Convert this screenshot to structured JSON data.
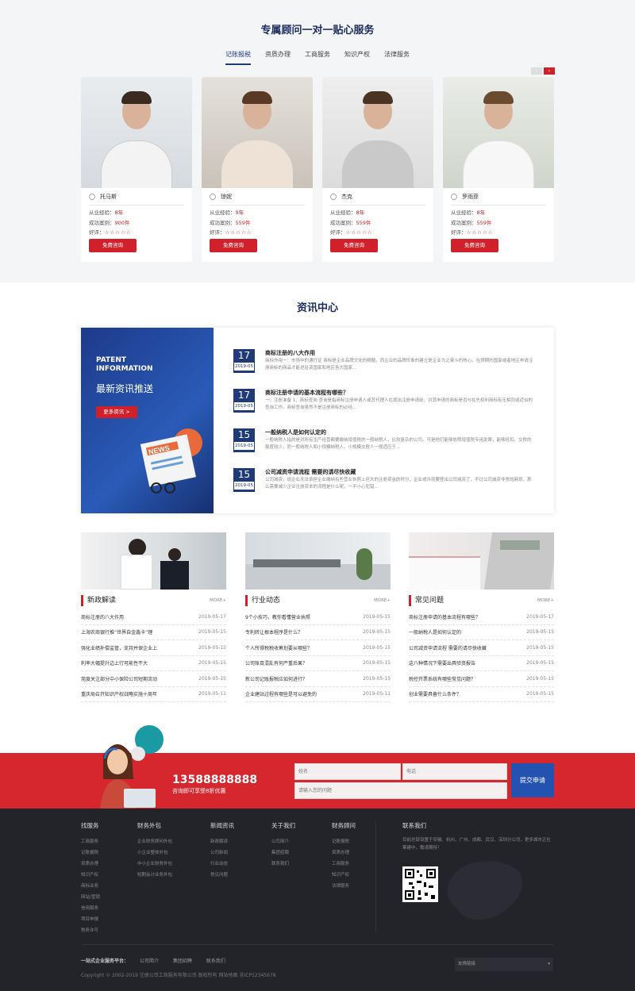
{
  "consult": {
    "title": "专属顾问一对一贴心服务",
    "tabs": [
      "记账报税",
      "资质办理",
      "工商服务",
      "知识产权",
      "法律服务"
    ],
    "exp_label": "从业经验：",
    "cases_label": "成功案例：",
    "rating_label": "好评：",
    "stars": "☆☆☆☆☆",
    "btn": "免费咨询",
    "advisors": [
      {
        "name": "托马斯",
        "exp": "8年",
        "cases": "900件"
      },
      {
        "name": "琼妮",
        "exp": "9年",
        "cases": "559件"
      },
      {
        "name": "杰克",
        "exp": "8年",
        "cases": "559件"
      },
      {
        "name": "罗雨菲",
        "exp": "8年",
        "cases": "559件"
      }
    ]
  },
  "news": {
    "title": "资讯中心",
    "banner_en": "PATENT INFORMATION",
    "banner_cn": "最新资讯推送",
    "banner_btn": "更多资讯 >",
    "banner_news": "NEWS",
    "items": [
      {
        "day": "17",
        "ym": "2019-05",
        "title": "商标注册的八大作用",
        "desc": "商标作用一：市场中的通行证 商标是企业品牌文化的精髓，而企业的品牌形象的建立是企业为之奋斗的核心。在预期的国家或者地区申请注册商标的商品才能进驻该国家和地区各大国家..."
      },
      {
        "day": "17",
        "ym": "2019-05",
        "title": "商标注册申请的基本流程有哪些？",
        "desc": "一、注册准备 1、商标查询 查询是指商标注册申请人或其代理人在提出注册申请前，对其申请的商标是否与在先权利商标有无相同或近似的查询工作。商标查询虽然不是注册商标的必经..."
      },
      {
        "day": "15",
        "ym": "2019-05",
        "title": "一般纳税人是如何认定的",
        "desc": "一般纳税人指的是对所有生产经营都要缴纳增值税的一般纳税人，比较复杂的公司。可是他们能够依照增值税专用发票，能够抵扣。交税的额度较少，而一般纳税人和小规模纳税人。小规模交税人一般适应于..."
      },
      {
        "day": "15",
        "ym": "2019-05",
        "title": "公司减资申请流程 需要的请尽快收藏",
        "desc": "公司减资，说企业无法承担企业缴纳有些营业执照上巨大的注册资金的时分，企业或许就要登出公司减资了，不过公司减资非常的麻烦，那么需要减少企业注册资本的流程是什么呢，一不小心犯错..."
      }
    ]
  },
  "columns": [
    {
      "title": "新政解读",
      "more": "MORE+",
      "rows": [
        {
          "t": "商标注册的八大作用",
          "d": "2019-05-17"
        },
        {
          "t": "上海农商银行推“世界自金鑫卡”理",
          "d": "2019-05-15"
        },
        {
          "t": "强化业绩补偿监管，支持并保企业上",
          "d": "2019-05-15"
        },
        {
          "t": "利率大幅提升边上行可能性不大",
          "d": "2019-05-15"
        },
        {
          "t": "莞度关注部分中小保险公司短期流动",
          "d": "2019-05-15"
        },
        {
          "t": "重庆局召开知识产权战略实施十周年",
          "d": "2019-05-11"
        }
      ]
    },
    {
      "title": "行业动态",
      "more": "MORE+",
      "rows": [
        {
          "t": "9个小技巧，教你看懂营业执照",
          "d": "2019-05-15"
        },
        {
          "t": "专利转让根本程序是什么？",
          "d": "2019-05-15"
        },
        {
          "t": "个人所得税税收筹划要从哪些？",
          "d": "2019-05-15"
        },
        {
          "t": "公司账目混乱有何严重后果？",
          "d": "2019-05-15"
        },
        {
          "t": "新公司记账报税应如何进行？",
          "d": "2019-05-15"
        },
        {
          "t": "企业建站过程有哪些是可以避免的",
          "d": "2019-05-11"
        }
      ]
    },
    {
      "title": "常见问题",
      "more": "MORE+",
      "rows": [
        {
          "t": "商标注册申请的基本流程有哪些？",
          "d": "2019-05-17"
        },
        {
          "t": "一般纳税人是如何认定的",
          "d": "2019-05-15"
        },
        {
          "t": "公司减资申请流程 需要的请尽快收藏",
          "d": "2019-05-15"
        },
        {
          "t": "这八种情况下需要出具验资报告",
          "d": "2019-05-15"
        },
        {
          "t": "税控开票系统有哪些常见问题？",
          "d": "2019-05-15"
        },
        {
          "t": "创业需要具备什么条件？",
          "d": "2019-05-15"
        }
      ]
    }
  ],
  "contact": {
    "phone": "13588888888",
    "phone_sub": "咨询即可享受8折优惠",
    "name_ph": "姓名",
    "tel_ph": "电话",
    "question_ph": "请输入您的问题",
    "submit": "提交申请"
  },
  "footer": {
    "cols": [
      {
        "h": "找服务",
        "items": [
          "工商服务",
          "记账报税",
          "资质办理",
          "知识产权",
          "商标业务",
          "网站/营销",
          "信用服务",
          "项目申报",
          "税务许可"
        ]
      },
      {
        "h": "财务外包",
        "items": [
          "企业财务顾问外包",
          "小企业整体外包",
          "中小企业财务外包",
          "短期会计业务外包"
        ]
      },
      {
        "h": "新闻资讯",
        "items": [
          "新政解读",
          "公司新闻",
          "行业动态",
          "常见问题"
        ]
      },
      {
        "h": "关于我们",
        "items": [
          "公司简介",
          "集团招聘",
          "联系我们"
        ]
      },
      {
        "h": "财务顾问",
        "items": [
          "记账报税",
          "资质办理",
          "工商服务",
          "知识产权",
          "法律服务"
        ]
      }
    ],
    "contact_h": "联系我们",
    "contact_text": "目前总部设置于安徽、杭州、广州、成都、武汉、深圳分公司，更多城市正在筹建中，敬请期待！",
    "platform_label": "一站式企业服务平台：",
    "platform_links": [
      "公司简介",
      "集团招聘",
      "联系我们"
    ],
    "copyright": "Copyright © 2002-2019 注册公司工商服务有限公司 版权所有    网站地图   苏ICP12345678",
    "friend_link": "友情链接"
  }
}
